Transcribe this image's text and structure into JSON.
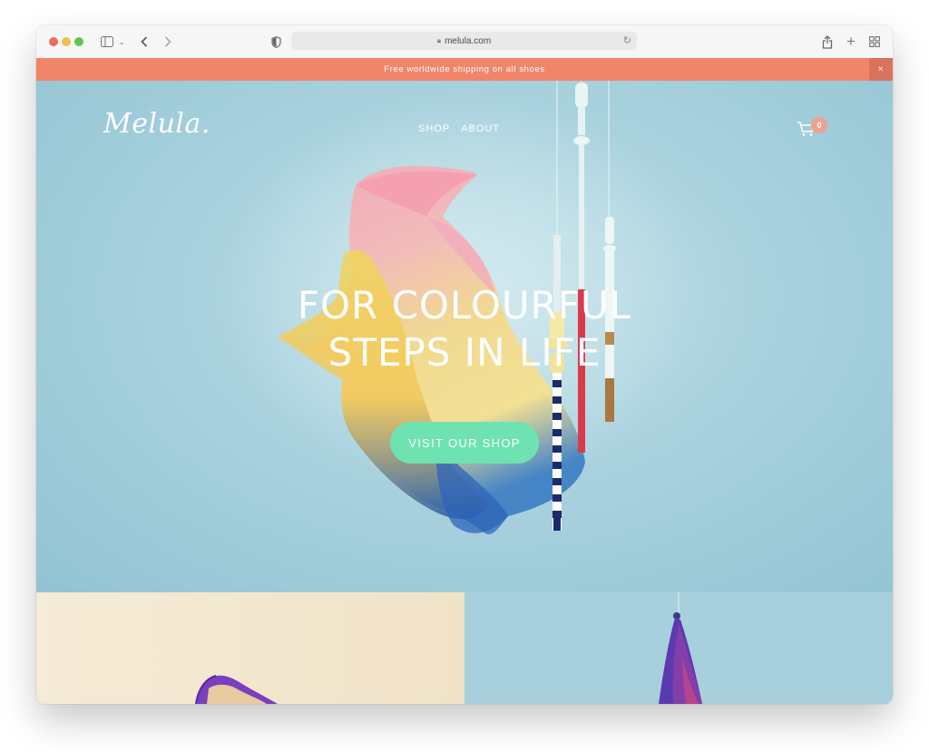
{
  "browser": {
    "url": "melula.com",
    "icons": [
      "sidebar-icon",
      "chevron-down-icon",
      "back-icon",
      "forward-icon",
      "shield-icon",
      "lock-icon",
      "reload-icon",
      "share-icon",
      "new-tab-icon",
      "tab-overview-icon"
    ]
  },
  "announcement": {
    "text": "Free worldwide shipping on all shoes",
    "close": "×"
  },
  "header": {
    "logo": "Melula.",
    "nav": [
      "SHOP",
      "ABOUT"
    ],
    "cart_count": "0"
  },
  "hero": {
    "headline_line1": "FOR COLOURFUL",
    "headline_line2": "STEPS IN LIFE",
    "cta": "VISIT OUR SHOP"
  },
  "colors": {
    "announcement_bg": "#f0856a",
    "hero_bg": "#a9d2de",
    "cta_bg": "#6ee3b1",
    "cart_badge": "#f0a18c",
    "tile_left_bg": "#f3e7cf",
    "tile_right_bg": "#a8d0dc"
  }
}
